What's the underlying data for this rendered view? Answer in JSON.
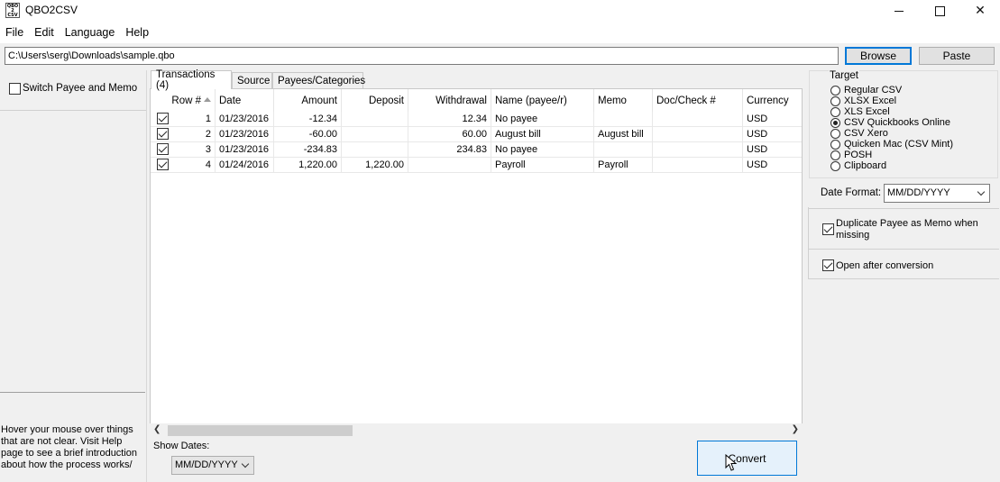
{
  "window": {
    "title": "QBO2CSV",
    "app_icon_text": "QBO\n2\nCSV"
  },
  "menu": [
    "File",
    "Edit",
    "Language",
    "Help"
  ],
  "path": {
    "value": "C:\\Users\\serg\\Downloads\\sample.qbo",
    "browse_label": "Browse",
    "paste_label": "Paste"
  },
  "left_panel": {
    "switch_label": "Switch Payee and Memo",
    "switch_checked": false,
    "help_text": "Hover your mouse over things that are not clear. Visit Help page to see a brief introduction about how the process works/"
  },
  "tabs": [
    {
      "label": "Transactions (4)",
      "active": true
    },
    {
      "label": "Source",
      "active": false
    },
    {
      "label": "Payees/Categories",
      "active": false
    }
  ],
  "table": {
    "columns": [
      "Row #",
      "Date",
      "Amount",
      "Deposit",
      "Withdrawal",
      "Name (payee/r)",
      "Memo",
      "Doc/Check #",
      "Currency"
    ],
    "rows": [
      {
        "checked": true,
        "row": "1",
        "date": "01/23/2016",
        "amount": "-12.34",
        "deposit": "",
        "withdrawal": "12.34",
        "name": "No payee",
        "memo": "",
        "doc": "",
        "currency": "USD"
      },
      {
        "checked": true,
        "row": "2",
        "date": "01/23/2016",
        "amount": "-60.00",
        "deposit": "",
        "withdrawal": "60.00",
        "name": "August bill",
        "memo": "August bill",
        "doc": "",
        "currency": "USD"
      },
      {
        "checked": true,
        "row": "3",
        "date": "01/23/2016",
        "amount": "-234.83",
        "deposit": "",
        "withdrawal": "234.83",
        "name": "No payee",
        "memo": "",
        "doc": "",
        "currency": "USD"
      },
      {
        "checked": true,
        "row": "4",
        "date": "01/24/2016",
        "amount": "1,220.00",
        "deposit": "1,220.00",
        "withdrawal": "",
        "name": "Payroll",
        "memo": "Payroll",
        "doc": "",
        "currency": "USD"
      }
    ]
  },
  "bottom": {
    "show_dates_label": "Show Dates:",
    "show_dates_value": "MM/DD/YYYY",
    "convert_label": "Convert"
  },
  "right_panel": {
    "target_title": "Target",
    "targets": [
      {
        "label": "Regular CSV",
        "checked": false
      },
      {
        "label": "XLSX Excel",
        "checked": false
      },
      {
        "label": "XLS Excel",
        "checked": false
      },
      {
        "label": "CSV Quickbooks Online",
        "checked": true
      },
      {
        "label": "CSV Xero",
        "checked": false
      },
      {
        "label": "Quicken Mac (CSV Mint)",
        "checked": false
      },
      {
        "label": "POSH",
        "checked": false
      },
      {
        "label": "Clipboard",
        "checked": false
      }
    ],
    "date_format_label": "Date Format:",
    "date_format_value": "MM/DD/YYYY",
    "duplicate_payee_label": "Duplicate Payee as Memo when missing",
    "duplicate_payee_checked": true,
    "open_after_label": "Open after conversion",
    "open_after_checked": true
  }
}
